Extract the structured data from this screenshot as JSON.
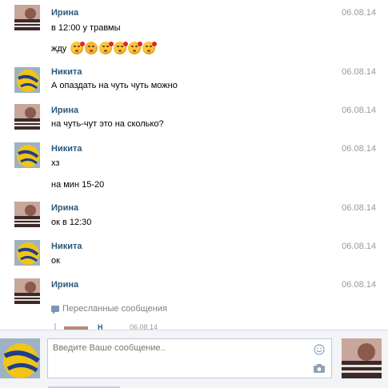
{
  "messages": [
    {
      "author": "Ирина",
      "date": "06.08.14",
      "lines": [
        "в 12:00 у травмы",
        "жду"
      ],
      "avatar": "irina"
    },
    {
      "author": "Никита",
      "date": "06.08.14",
      "lines": [
        "А опаздать на чуть чуть можно"
      ],
      "avatar": "nikita"
    },
    {
      "author": "Ирина",
      "date": "06.08.14",
      "lines": [
        "на чуть-чут это на сколько?"
      ],
      "avatar": "irina"
    },
    {
      "author": "Никита",
      "date": "06.08.14",
      "lines": [
        "хз",
        "на мин 15-20"
      ],
      "avatar": "nikita"
    },
    {
      "author": "Ирина",
      "date": "06.08.14",
      "lines": [
        "ок в 12:30"
      ],
      "avatar": "irina"
    },
    {
      "author": "Никита",
      "date": "06.08.14",
      "lines": [
        "ок"
      ],
      "avatar": "nikita"
    },
    {
      "author": "Ирина",
      "date": "06.08.14",
      "lines": [],
      "avatar": "irina"
    }
  ],
  "emoji_count": 6,
  "emoji_icon": "kissing-face-heart-icon",
  "forwarded": {
    "label": "Пересланные сообщения",
    "icon": "forwarded-message-icon",
    "peek_name": "Н",
    "peek_date": "06.08.14"
  },
  "composer": {
    "placeholder": "Введите Ваше сообщение..",
    "smile_icon": "smile-icon",
    "camera_icon": "camera-icon"
  },
  "colors": {
    "author": "#2b587a",
    "date": "#999999",
    "composer_bg": "#f2f4f7"
  }
}
